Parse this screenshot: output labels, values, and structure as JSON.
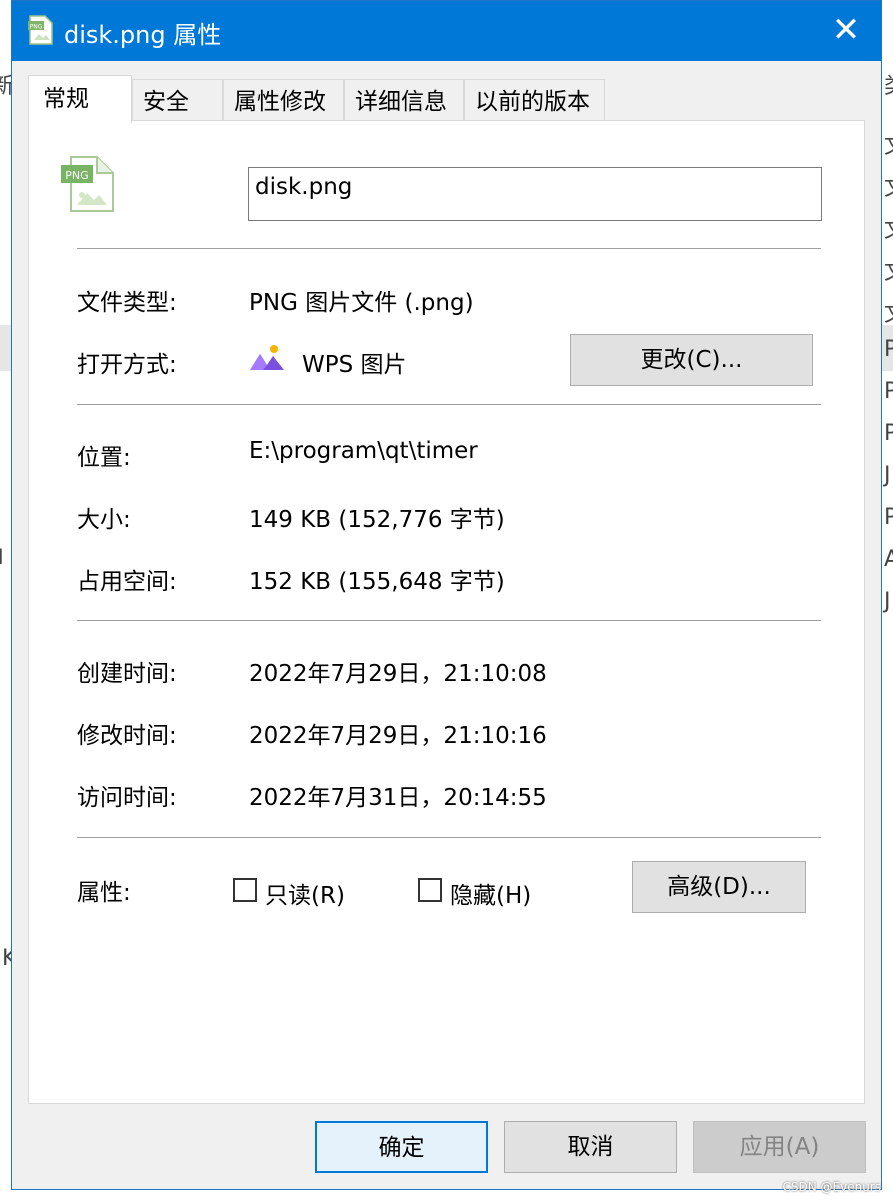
{
  "window": {
    "title": "disk.png 属性",
    "close_glyph": "✕"
  },
  "tabs": [
    {
      "label": "常规",
      "active": true
    },
    {
      "label": "安全"
    },
    {
      "label": "属性修改"
    },
    {
      "label": "详细信息"
    },
    {
      "label": "以前的版本"
    }
  ],
  "file": {
    "icon_label": "PNG",
    "name": "disk.png"
  },
  "general": {
    "type_label": "文件类型:",
    "type_value": "PNG 图片文件 (.png)",
    "open_label": "打开方式:",
    "open_value": "WPS 图片",
    "change_button": "更改(C)...",
    "location_label": "位置:",
    "location_value": "E:\\program\\qt\\timer",
    "size_label": "大小:",
    "size_value": "149 KB (152,776 字节)",
    "disk_label": "占用空间:",
    "disk_value": "152 KB (155,648 字节)",
    "created_label": "创建时间:",
    "created_value": "2022年7月29日，21:10:08",
    "modified_label": "修改时间:",
    "modified_value": "2022年7月29日，21:10:16",
    "accessed_label": "访问时间:",
    "accessed_value": "2022年7月31日，20:14:55",
    "attr_label": "属性:",
    "readonly_label": "只读(R)",
    "readonly_checked": false,
    "hidden_label": "隐藏(H)",
    "hidden_checked": false,
    "advanced_button": "高级(D)..."
  },
  "footer": {
    "ok": "确定",
    "cancel": "取消",
    "apply": "应用(A)",
    "apply_enabled": false
  },
  "background": {
    "left_glyphs": [
      "新",
      "l",
      "K"
    ],
    "right_glyphs": [
      "类",
      "文",
      "文",
      "文",
      "文",
      "文",
      "P",
      "P",
      "P",
      "J",
      "P",
      "A",
      "J"
    ]
  },
  "watermark": "CSDN @Evenurs",
  "colors": {
    "titlebar": "#0078d7",
    "ok_border": "#0078d7",
    "panel": "#ffffff",
    "dialog": "#f0f0f0"
  }
}
